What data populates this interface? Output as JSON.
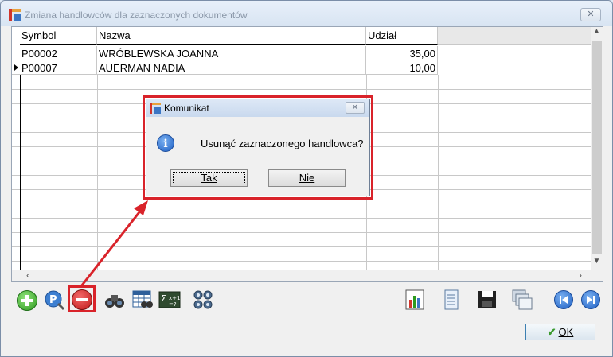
{
  "window": {
    "title": "Zmiana handlowców dla zaznaczonych dokumentów",
    "close_label": "✕"
  },
  "grid": {
    "columns": [
      "Symbol",
      "Nazwa",
      "Udział"
    ],
    "rows": [
      {
        "symbol": "P00002",
        "name": "WRÓBLEWSKA JOANNA",
        "share": "35,00"
      },
      {
        "symbol": "P00007",
        "name": "AUERMAN NADIA",
        "share": "10,00"
      }
    ]
  },
  "dialog": {
    "title": "Komunikat",
    "message": "Usunąć zaznaczonego handlowca?",
    "yes": "Tak",
    "no": "Nie",
    "close_label": "✕"
  },
  "footer": {
    "ok_label": "OK"
  },
  "colors": {
    "highlight": "#d9232a",
    "accent": "#3c7fb1"
  }
}
